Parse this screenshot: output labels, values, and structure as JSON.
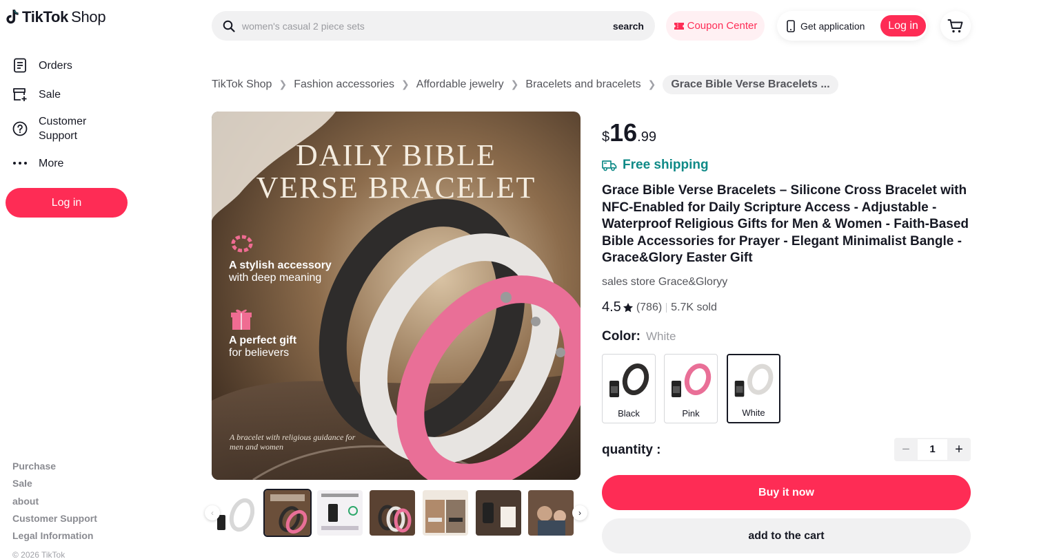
{
  "logo": {
    "brand": "TikTok",
    "suffix": "Shop",
    "icon": "tiktok-note-icon"
  },
  "sidebar": {
    "items": [
      {
        "label": "Orders",
        "icon": "orders-icon"
      },
      {
        "label": "Sale",
        "icon": "store-add-icon"
      },
      {
        "label": "Customer Support",
        "icon": "help-circle-icon"
      },
      {
        "label": "More",
        "icon": "more-dots-icon"
      }
    ],
    "login_label": "Log in",
    "footer_links": [
      "Purchase",
      "Sale",
      "about",
      "Customer Support",
      "Legal Information"
    ],
    "copyright": "© 2026 TikTok"
  },
  "header": {
    "search_placeholder": "women's casual 2 piece sets",
    "search_button": "search",
    "coupon_label": "Coupon Center",
    "get_app_label": "Get application",
    "login_label": "Log in",
    "cart_icon": "cart-icon"
  },
  "breadcrumb": {
    "items": [
      "TikTok Shop",
      "Fashion accessories",
      "Affordable jewelry",
      "Bracelets and bracelets"
    ],
    "current": "Grace Bible Verse Bracelets ..."
  },
  "gallery": {
    "main_image": {
      "title_line1": "DAILY BIBLE",
      "title_line2": "VERSE BRACELET",
      "feature1_bold": "A stylish accessory",
      "feature1_regular": "with deep meaning",
      "feature2_bold": "A perfect gift",
      "feature2_regular": "for believers",
      "caption": "A bracelet with religious guidance for men and women"
    },
    "thumbnail_count": 7,
    "active_thumbnail": 1
  },
  "product": {
    "price_currency": "$",
    "price_integer": "16",
    "price_decimal": ".99",
    "shipping": "Free shipping",
    "title": "Grace Bible Verse Bracelets – Silicone Cross Bracelet with NFC-Enabled for Daily Scripture Access - Adjustable - Waterproof Religious Gifts for Men & Women - Faith-Based Bible Accessories for Prayer - Elegant Minimalist Bangle - Grace&Glory Easter Gift",
    "store": "sales store Grace&Gloryy",
    "rating": "4.5",
    "reviews": "(786)",
    "sold": "5.7K sold",
    "color_label": "Color:",
    "color_value": "White",
    "colors": [
      "Black",
      "Pink",
      "White"
    ],
    "selected_color": "White",
    "quantity_label": "quantity :",
    "quantity": "1",
    "buy_label": "Buy it now",
    "cart_label": "add to the cart"
  },
  "colors": {
    "brand": "#fe2c55",
    "shipping": "#0f8a87",
    "coupon_bg": "#fff0f3"
  }
}
